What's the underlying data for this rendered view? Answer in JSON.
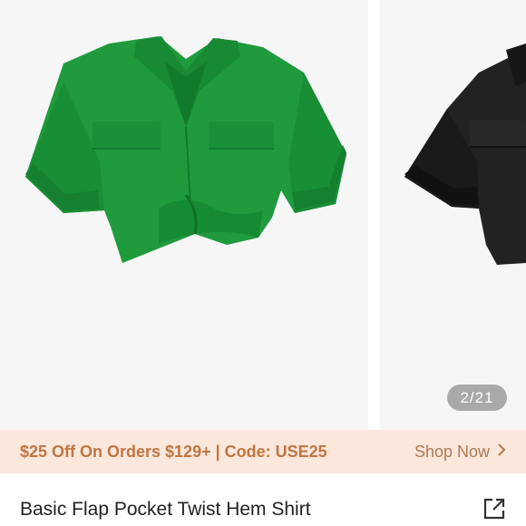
{
  "gallery": {
    "counter": "2/21",
    "images": [
      {
        "alt": "Green cropped shirt",
        "color": "#1a9a3a"
      },
      {
        "alt": "Black cropped shirt",
        "color": "#1c1c1c"
      }
    ]
  },
  "promo": {
    "text": "$25 Off On Orders $129+ | Code: USE25",
    "link_label": "Shop Now",
    "link_icon": "chevron-right-icon"
  },
  "product": {
    "title": "Basic Flap Pocket Twist Hem Shirt",
    "share_icon": "share-external-icon"
  }
}
